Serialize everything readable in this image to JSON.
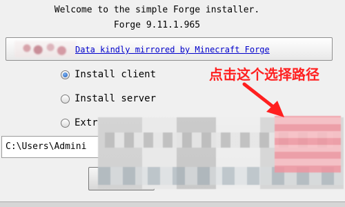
{
  "header": {
    "welcome": "Welcome to the simple Forge installer.",
    "version": "Forge 9.11.1.965"
  },
  "mirror": {
    "label": "Data kindly mirrored by Minecraft Forge"
  },
  "options": [
    {
      "label": "Install client",
      "checked": true
    },
    {
      "label": "Install server",
      "checked": false
    },
    {
      "label": "Extra",
      "checked": false
    }
  ],
  "path": {
    "value": "C:\\Users\\Admini"
  },
  "annotation": {
    "text": "点击这个选择路径",
    "color": "#ff1f1f"
  }
}
